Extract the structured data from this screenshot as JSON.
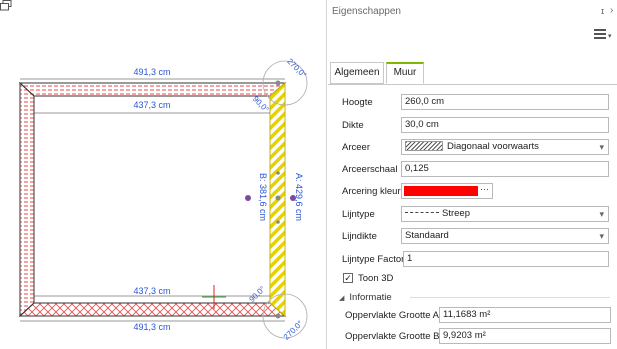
{
  "panel": {
    "title": "Eigenschappen",
    "pin_icon": "pin-icon",
    "close_icon": "close-icon",
    "menu_icon": "hamburger-menu-icon"
  },
  "tabs": [
    {
      "label": "Algemeen",
      "active": false
    },
    {
      "label": "Muur",
      "active": true
    }
  ],
  "properties": {
    "hoogte": {
      "label": "Hoogte",
      "value": "260,0 cm"
    },
    "dikte": {
      "label": "Dikte",
      "value": "30,0 cm"
    },
    "arceer": {
      "label": "Arceer",
      "value": "Diagonaal voorwaarts"
    },
    "arceerschaal": {
      "label": "Arceerschaal",
      "value": "0,125"
    },
    "arcering_kleur": {
      "label": "Arcering kleur",
      "color": "#ff0000",
      "button": "···"
    },
    "lijntype": {
      "label": "Lijntype",
      "value": "Streep"
    },
    "lijndikte": {
      "label": "Lijndikte",
      "value": "Standaard"
    },
    "lijntype_factor": {
      "label": "Lijntype Factor",
      "value": "1"
    },
    "toon3d": {
      "label": "Toon 3D",
      "checked": true,
      "mark": "✓"
    }
  },
  "informatie": {
    "header": "Informatie",
    "toggle": "◢",
    "rows": [
      {
        "label": "Oppervlakte Grootte A",
        "value": "11,1683 m²"
      },
      {
        "label": "Oppervlakte Grootte B",
        "value": "9,9203 m²"
      }
    ]
  },
  "drawing": {
    "top_outer": "491,3 cm",
    "top_inner": "437,3 cm",
    "bottom_inner": "437,3 cm",
    "bottom_outer": "491,3 cm",
    "right_wall_a": "A: 429,6 cm",
    "right_wall_b": "B: 381,6 cm",
    "angle_tr_outer": "270,0°",
    "angle_tr_inner": "90,0°",
    "angle_br_inner": "90,0°",
    "angle_br_outer": "270,0°",
    "colors": {
      "dim_text": "#2a56d6",
      "selected_wall": "#f2d900",
      "wall_hatch": "#e84a4a"
    }
  }
}
